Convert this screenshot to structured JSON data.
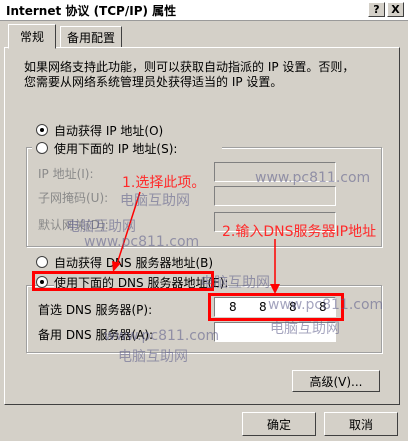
{
  "window": {
    "title": "Internet 协议 (TCP/IP) 属性",
    "help_btn": "?",
    "close_btn": "X"
  },
  "tabs": [
    {
      "label": "常规"
    },
    {
      "label": "备用配置"
    }
  ],
  "description": [
    "如果网络支持此功能，则可以获取自动指派的 IP 设置。否则，",
    "您需要从网络系统管理员处获得适当的 IP 设置。"
  ],
  "ip": {
    "auto_label": "自动获得 IP 地址(O)",
    "manual_label": "使用下面的 IP 地址(S):",
    "address_label": "IP 地址(I):",
    "subnet_label": "子网掩码(U):",
    "gateway_label": "默认网关(D):"
  },
  "dns": {
    "auto_label": "自动获得 DNS 服务器地址(B)",
    "manual_label": "使用下面的 DNS 服务器地址(E):",
    "preferred_label": "首选 DNS 服务器(P):",
    "preferred_value": [
      "8",
      "8",
      "8",
      "8"
    ],
    "alternate_label": "备用 DNS 服务器(A):"
  },
  "buttons": {
    "advanced": "高级(V)...",
    "ok": "确定",
    "cancel": "取消"
  },
  "annotations": {
    "step1": "1.选择此项。",
    "step2": "2.输入DNS服务器IP地址",
    "colors": {
      "red": "#ff0000"
    }
  },
  "watermarks": [
    "www.pc811.com",
    "电脑互助网",
    "电脑互助网",
    "www.pc811.com",
    "电脑互助网",
    "www.pc811.com",
    "电脑互助网",
    "www.pc811.com",
    "电脑互助网"
  ]
}
